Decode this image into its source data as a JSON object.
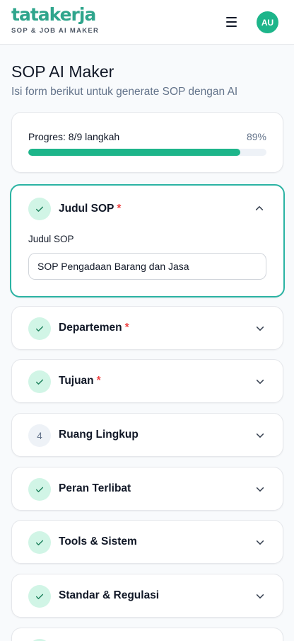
{
  "header": {
    "logo_text": "tatakerja",
    "logo_subtitle": "SOP & JOB AI MAKER",
    "avatar_initials": "AU",
    "menu_icon": "hamburger-menu-icon"
  },
  "page": {
    "title": "SOP AI Maker",
    "subtitle": "Isi form berikut untuk generate SOP dengan AI"
  },
  "progress": {
    "label": "Progres: 8/9 langkah",
    "percent_label": "89%",
    "fraction": 0.89
  },
  "steps": [
    {
      "title": "Judul SOP",
      "required": true,
      "done": true,
      "open": true,
      "field_label": "Judul SOP",
      "field_value": "SOP Pengadaan Barang dan Jasa"
    },
    {
      "title": "Departemen",
      "required": true,
      "done": true
    },
    {
      "title": "Tujuan",
      "required": true,
      "done": true
    },
    {
      "title": "Ruang Lingkup",
      "required": false,
      "done": false,
      "number": "4"
    },
    {
      "title": "Peran Terlibat",
      "required": false,
      "done": true
    },
    {
      "title": "Tools & Sistem",
      "required": false,
      "done": true
    },
    {
      "title": "Standar & Regulasi",
      "required": false,
      "done": true
    }
  ],
  "required_marker": "*",
  "colors": {
    "brand": "#2fa58c",
    "accent": "#1db58a",
    "open_border": "#2bb3a3",
    "required": "#ef4444"
  }
}
